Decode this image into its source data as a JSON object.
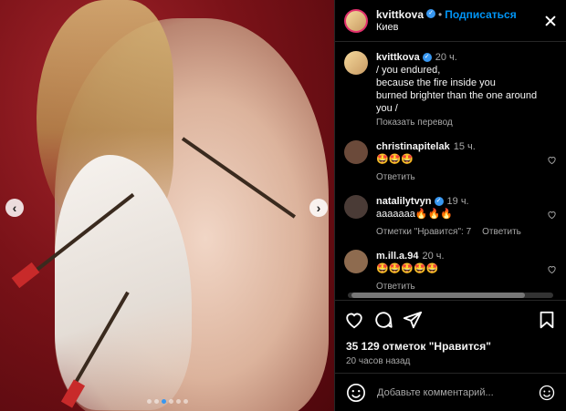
{
  "media": {
    "slide_count": 6,
    "active_slide": 2
  },
  "header": {
    "username": "kvittkova",
    "separator": "•",
    "follow_label": "Подписаться",
    "location": "Киев"
  },
  "caption": {
    "username": "kvittkova",
    "time": "20 ч.",
    "text": "/ you endured,\nbecause the fire inside you\nburned brighter than the one around\nyou /",
    "translate": "Показать перевод"
  },
  "comments": [
    {
      "username": "christinapitelak",
      "time": "15 ч.",
      "text": "🤩🤩🤩",
      "reply": "Ответить",
      "likes": "",
      "avatar_color": "#6b4a3a"
    },
    {
      "username": "natalilytvyn",
      "time": "19 ч.",
      "text": "ааааааа🔥🔥🔥",
      "reply": "Ответить",
      "likes": "Отметки \"Нравится\": 7",
      "avatar_color": "#4a3b36"
    },
    {
      "username": "m.ill.a.94",
      "time": "20 ч.",
      "text": "🤩🤩🤩🤩🤩",
      "reply": "Ответить",
      "likes": "",
      "avatar_color": "#8e6b4f"
    }
  ],
  "stats": {
    "likes": "35 129 отметок \"Нравится\"",
    "posted": "20 часов назад"
  },
  "add_comment": {
    "placeholder": "Добавьте комментарий..."
  },
  "colors": {
    "accent": "#0095f6",
    "verified": "#3897f0",
    "background": "#000000"
  }
}
